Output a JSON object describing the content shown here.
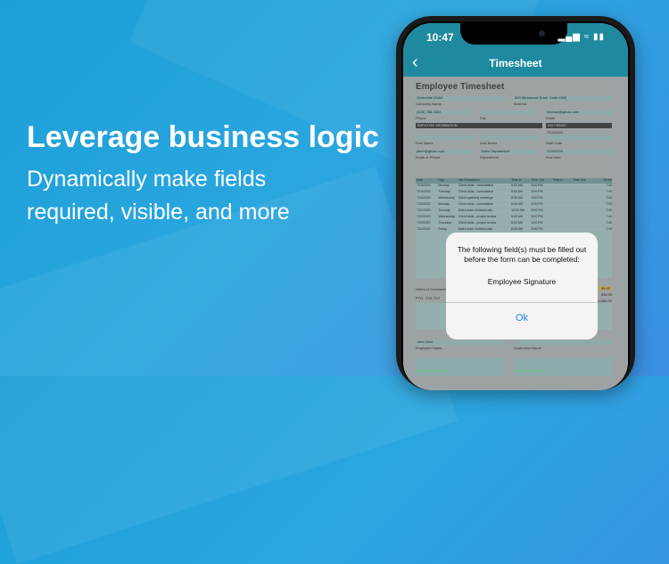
{
  "promo": {
    "headline": "Leverage business logic",
    "subline_1": "Dynamically make fields",
    "subline_2": "required, visible, and more"
  },
  "status_bar": {
    "time": "10:47"
  },
  "nav": {
    "title": "Timesheet"
  },
  "form": {
    "title": "Employee Timesheet",
    "company_value": "Greenville HVAC",
    "company_label": "Company Name",
    "address_value": "800 Westwood Drive, Suite #300",
    "address_label": "Address",
    "phone_value": "(425) 788-3302",
    "phone_label": "Phone",
    "fax_label": "Fax",
    "email_value": "michael@gfnac.com",
    "email_label": "Email",
    "emp_info_header": "EMPLOYEE INFORMATION",
    "pay_period_header": "PAY PERIOD",
    "start_date_value": "7/13/2020",
    "first_name_label": "First Name",
    "last_name_label": "Last Name",
    "start_date_label": "Start Date",
    "emp_email_value": "jdeer@gfnac.com",
    "dept_value": "Sales Department",
    "end_date_value": "7/24/2020",
    "email_phone_label": "Email or Phone",
    "dept_label": "Department",
    "end_date_label": "End Date",
    "table_headers": [
      "Date",
      "Day",
      "Job Description",
      "Time In",
      "Time Out",
      "Time In",
      "Time Out",
      "Hours"
    ],
    "rows": [
      [
        "7/13/2020",
        "Monday",
        "Client visits - consultation",
        "8:00 AM",
        "3:00 PM",
        "",
        "",
        "7.00"
      ],
      [
        "7/14/2020",
        "Tuesday",
        "Client visits - consultation",
        "8:00 AM",
        "3:00 PM",
        "",
        "",
        "7.00"
      ],
      [
        "7/15/2020",
        "Wednesday",
        "Client quarterly meetings",
        "8:00 AM",
        "3:00 PM",
        "",
        "",
        "7.00"
      ],
      [
        "7/20/2020",
        "Monday",
        "Client visits - consultation",
        "8:00 AM",
        "3:00 PM",
        "",
        "",
        "7.00"
      ],
      [
        "7/21/2020",
        "Tuesday",
        "Sales team reviews/calls",
        "10:00 AM",
        "5:00 PM",
        "",
        "",
        "7.00"
      ],
      [
        "7/22/2020",
        "Wednesday",
        "Client visits - project review",
        "8:00 AM",
        "3:00 PM",
        "",
        "",
        "7.00"
      ],
      [
        "7/23/2020",
        "Thursday",
        "Client visits - project review",
        "8:00 AM",
        "3:00 PM",
        "",
        "",
        "7.00"
      ],
      [
        "7/24/2020",
        "Friday",
        "Sales team reviews/calls",
        "8:00 AM",
        "3:00 PM",
        "",
        "",
        "7.00"
      ]
    ],
    "notes_label": "Notes or Comments",
    "total_hours": "56.00",
    "rate": "$30.00",
    "pto_label": "PTO: 7/16-7/17",
    "total_pay": "$1,680.00",
    "employee_name_value": "John Deer",
    "employee_name_label": "Employee Name",
    "supervisor_name_label": "Supervisor Name",
    "employee_signature_label": "Employee Signature",
    "supervisor_signature_label": "Supervisor Signature"
  },
  "dialog": {
    "message": "The following field(s) must be filled out before the form can be completed:",
    "field": "Employee Signature",
    "ok_label": "Ok"
  }
}
